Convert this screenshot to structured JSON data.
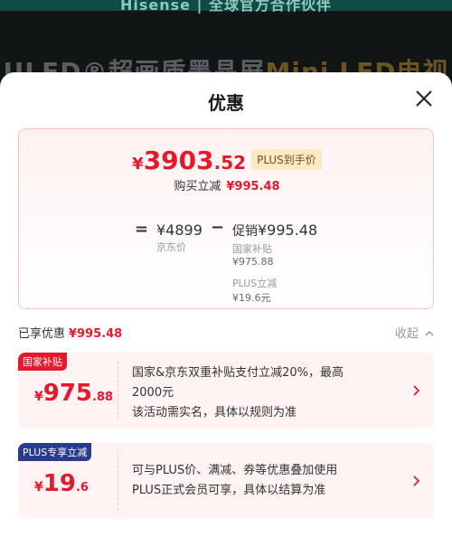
{
  "banner": {
    "top_text": "Hisense | 全球官方合作伙伴",
    "prefix": "ULED®超画质墨晶屏",
    "highlight": "Mini LED电视"
  },
  "sheet": {
    "title": "优惠",
    "close_icon": "close-icon"
  },
  "summary": {
    "final_price": {
      "currency": "¥",
      "integer": "3903",
      "decimal": ".52"
    },
    "plus_tag": "PLUS到手价",
    "save_label": "购买立减",
    "save_amount": "¥995.48",
    "equals": "=",
    "minus": "−",
    "jd_price": "¥4899",
    "jd_label": "京东价",
    "promo_label": "促销",
    "promo_amount": "¥995.48",
    "items": [
      {
        "label": "国家补贴",
        "value": "¥975.88"
      },
      {
        "label": "PLUS立减",
        "value": "¥19.6元"
      }
    ]
  },
  "enjoyed": {
    "label": "已享优惠",
    "amount": "¥995.48",
    "collapse_label": "收起"
  },
  "coupons": [
    {
      "tag": "国家补贴",
      "tag_color": "#e4192d",
      "currency": "¥",
      "integer": "975",
      "decimal": ".88",
      "line1": "国家&京东双重补贴支付立减20%，最高",
      "line2": "2000元",
      "line3": "该活动需实名，具体以规则为准"
    },
    {
      "tag": "PLUS专享立减",
      "tag_color": "#2a3a8c",
      "currency": "¥",
      "integer": "19",
      "decimal": ".6",
      "line1": "可与PLUS价、满减、券等优惠叠加使用",
      "line2": "PLUS正式会员可享，具体以结算为准"
    }
  ],
  "colors": {
    "accent_red": "#e4192d",
    "plus_tag_bg": "#fbe8c4",
    "plus_blue": "#2a3a8c"
  }
}
